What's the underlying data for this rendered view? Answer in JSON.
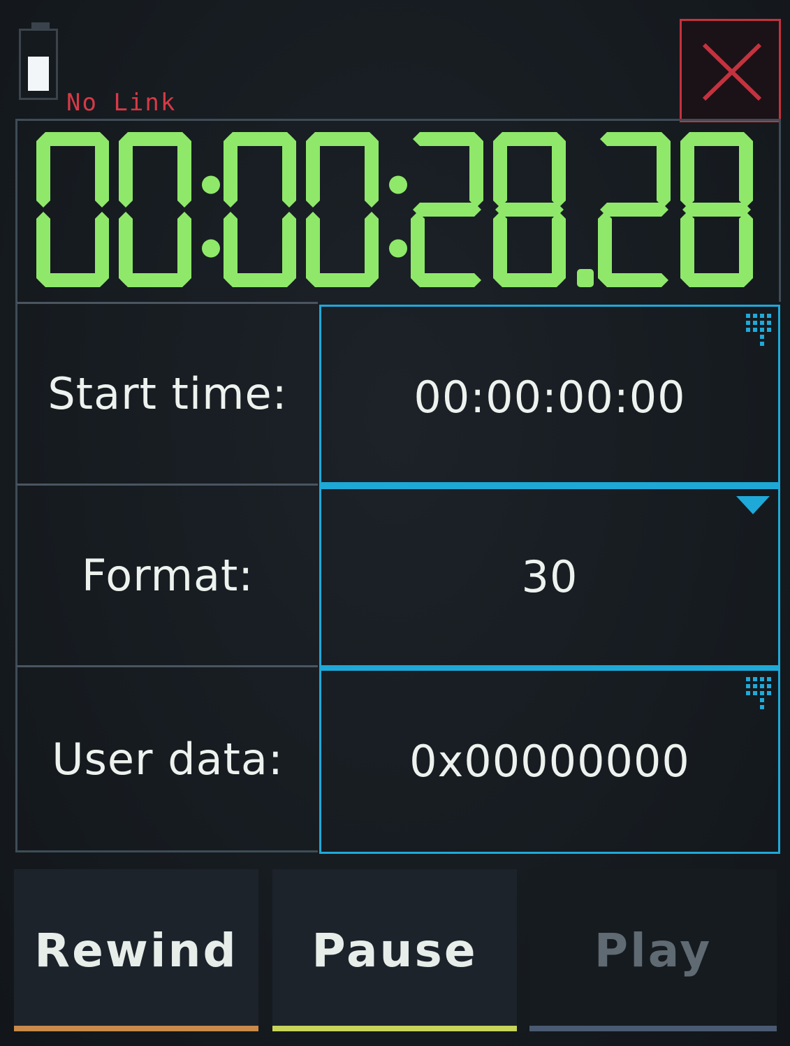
{
  "status": {
    "battery_level": 0.65,
    "link_status": "No Link"
  },
  "timecode": {
    "display": "00:00:28.28"
  },
  "settings": {
    "start_time": {
      "label": "Start time:",
      "value": "00:00:00:00"
    },
    "format": {
      "label": "Format:",
      "value": "30"
    },
    "user_data": {
      "label": "User data:",
      "value": "0x00000000"
    }
  },
  "controls": {
    "rewind": {
      "label": "Rewind",
      "accent": "#c98a4a",
      "enabled": true
    },
    "pause": {
      "label": "Pause",
      "accent": "#c7d45a",
      "enabled": true
    },
    "play": {
      "label": "Play",
      "accent": "#4a5a72",
      "enabled": false
    }
  },
  "colors": {
    "accent": "#1fa9d9",
    "digit_on": "#8fe86a",
    "digit_dim": "#3f7a2f",
    "alert": "#d63a45"
  },
  "icons": {
    "battery": "battery-icon",
    "close": "close-icon",
    "keypad": "keypad-icon",
    "dropdown": "dropdown-icon"
  }
}
